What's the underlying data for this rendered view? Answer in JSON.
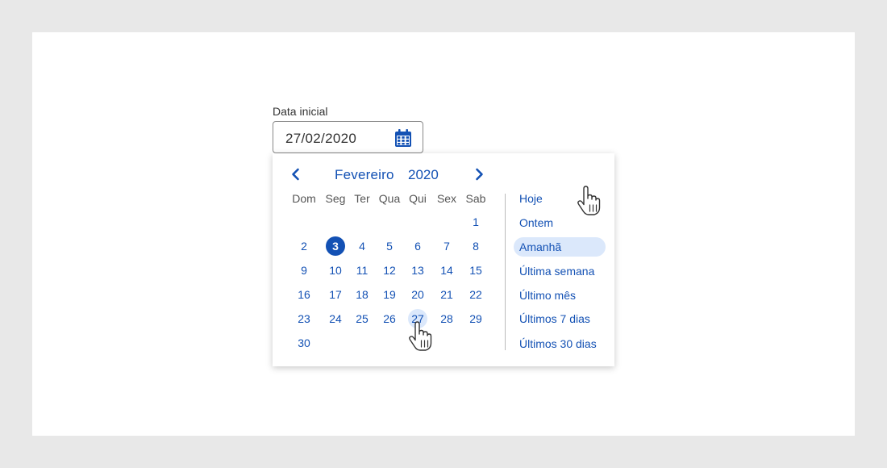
{
  "field": {
    "label": "Data inicial",
    "value": "27/02/2020",
    "icon": "calendar-icon"
  },
  "calendar": {
    "month": "Fevereiro",
    "year": "2020",
    "weekdays": [
      "Dom",
      "Seg",
      "Ter",
      "Qua",
      "Qui",
      "Sex",
      "Sab"
    ],
    "weeks": [
      [
        "",
        "",
        "",
        "",
        "",
        "",
        "1"
      ],
      [
        "2",
        "3",
        "4",
        "5",
        "6",
        "7",
        "8"
      ],
      [
        "9",
        "10",
        "11",
        "12",
        "13",
        "14",
        "15"
      ],
      [
        "16",
        "17",
        "18",
        "19",
        "20",
        "21",
        "22"
      ],
      [
        "23",
        "24",
        "25",
        "26",
        "27",
        "28",
        "29"
      ],
      [
        "30",
        "",
        "",
        "",
        "",
        "",
        ""
      ]
    ],
    "today": "3",
    "hovered": "27"
  },
  "shortcuts": [
    {
      "label": "Hoje",
      "active": false
    },
    {
      "label": "Ontem",
      "active": false
    },
    {
      "label": "Amanhã",
      "active": true
    },
    {
      "label": "Última semana",
      "active": false
    },
    {
      "label": "Último mês",
      "active": false
    },
    {
      "label": "Últimos 7 dias",
      "active": false
    },
    {
      "label": "Últimos 30 dias",
      "active": false
    }
  ],
  "colors": {
    "accent": "#1351b4",
    "highlight": "#dbe8fb"
  }
}
